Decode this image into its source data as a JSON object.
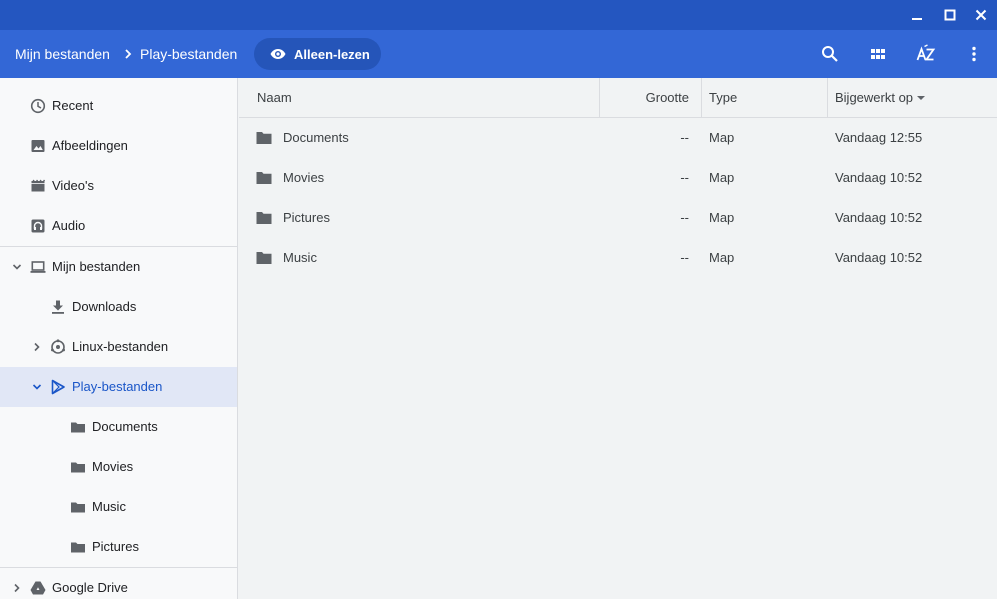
{
  "window_controls": {
    "minimize": "minimize-icon",
    "maximize": "maximize-icon",
    "close": "close-icon"
  },
  "toolbar": {
    "breadcrumb": [
      "Mijn bestanden",
      "Play-bestanden"
    ],
    "readonly_chip": "Alleen-lezen",
    "actions": [
      "search-icon",
      "grid-view-icon",
      "sort-az-icon",
      "more-vertical-icon"
    ]
  },
  "sidebar": {
    "recents": [
      {
        "label": "Recent",
        "icon": "clock-icon"
      },
      {
        "label": "Afbeeldingen",
        "icon": "image-icon"
      },
      {
        "label": "Video's",
        "icon": "film-icon"
      },
      {
        "label": "Audio",
        "icon": "audio-icon"
      }
    ],
    "my_files": {
      "label": "Mijn bestanden",
      "icon": "laptop-icon"
    },
    "downloads": {
      "label": "Downloads",
      "icon": "download-icon"
    },
    "linux": {
      "label": "Linux-bestanden",
      "icon": "linux-icon"
    },
    "play": {
      "label": "Play-bestanden",
      "icon": "play-icon"
    },
    "play_children": [
      {
        "label": "Documents",
        "icon": "folder-icon"
      },
      {
        "label": "Movies",
        "icon": "folder-icon"
      },
      {
        "label": "Music",
        "icon": "folder-icon"
      },
      {
        "label": "Pictures",
        "icon": "folder-icon"
      }
    ],
    "drive": {
      "label": "Google Drive",
      "icon": "drive-icon"
    }
  },
  "table": {
    "columns": {
      "name": "Naam",
      "size": "Grootte",
      "type": "Type",
      "modified": "Bijgewerkt op"
    },
    "rows": [
      {
        "name": "Documents",
        "size": "--",
        "type": "Map",
        "modified": "Vandaag 12:55"
      },
      {
        "name": "Movies",
        "size": "--",
        "type": "Map",
        "modified": "Vandaag 10:52"
      },
      {
        "name": "Pictures",
        "size": "--",
        "type": "Map",
        "modified": "Vandaag 10:52"
      },
      {
        "name": "Music",
        "size": "--",
        "type": "Map",
        "modified": "Vandaag 10:52"
      }
    ]
  },
  "colors": {
    "titlebar": "#2456c0",
    "toolbar": "#3367d6",
    "chip": "#2555b9",
    "selected_bg": "#e1e7f6",
    "selected_text": "#1a56c8"
  }
}
